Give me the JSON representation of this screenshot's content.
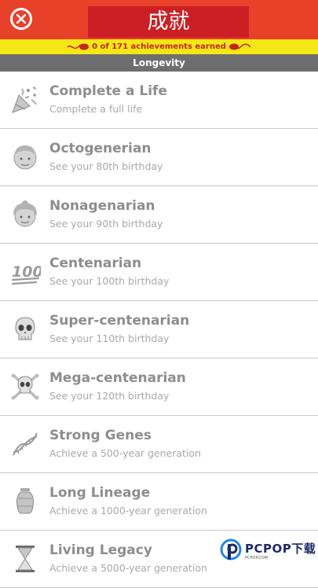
{
  "header": {
    "title": "成就",
    "close_icon": "close-x-icon",
    "colors": {
      "header_bg": "#e8412a",
      "title_block": "#cc1f25"
    }
  },
  "achievements_bar": {
    "text": "0 of 171 achievements earned",
    "colors": {
      "bg": "#f5e716",
      "text": "#c2271b"
    }
  },
  "section": {
    "title": "Longevity"
  },
  "items": [
    {
      "icon": "party-popper-icon",
      "name": "Complete a Life",
      "description": "Complete a full life"
    },
    {
      "icon": "old-man-face-icon",
      "name": "Octogenerian",
      "description": "See your 80th birthday"
    },
    {
      "icon": "old-woman-face-icon",
      "name": "Nonagenarian",
      "description": "See your 90th birthday"
    },
    {
      "icon": "hundred-points-icon",
      "name": "Centenarian",
      "description": "See your 100th birthday"
    },
    {
      "icon": "skull-icon",
      "name": "Super-centenarian",
      "description": "See your 110th birthday"
    },
    {
      "icon": "skull-crossbones-icon",
      "name": "Mega-centenarian",
      "description": "See your 120th birthday"
    },
    {
      "icon": "dna-icon",
      "name": "Strong Genes",
      "description": "Achieve a 500-year generation"
    },
    {
      "icon": "urn-icon",
      "name": "Long Lineage",
      "description": "Achieve a 1000-year generation"
    },
    {
      "icon": "hourglass-icon",
      "name": "Living Legacy",
      "description": "Achieve a 5000-year generation"
    }
  ],
  "watermark": {
    "text": "PCPOP下载",
    "subtext": "PCPOP.COM"
  }
}
